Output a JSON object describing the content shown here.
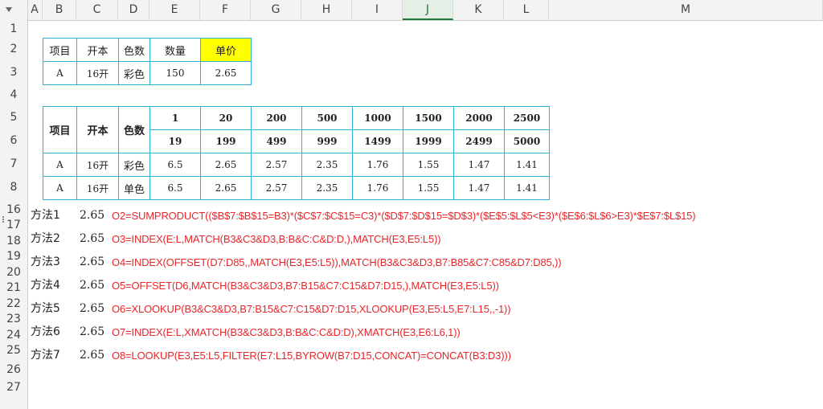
{
  "columns": [
    "A",
    "B",
    "C",
    "D",
    "E",
    "F",
    "G",
    "H",
    "I",
    "J",
    "K",
    "L",
    "M"
  ],
  "rows": [
    "1",
    "2",
    "3",
    "4",
    "5",
    "6",
    "7",
    "8",
    "16",
    "17",
    "18",
    "19",
    "20",
    "21",
    "22",
    "23",
    "24",
    "25",
    "26",
    "27"
  ],
  "table1": {
    "headers": [
      "项目",
      "开本",
      "色数",
      "数量",
      "单价"
    ],
    "row": [
      "A",
      "16开",
      "彩色",
      "150",
      "2.65"
    ]
  },
  "table2": {
    "head_left": [
      "项目",
      "开本",
      "色数"
    ],
    "range_from": [
      "1",
      "20",
      "200",
      "500",
      "1000",
      "1500",
      "2000",
      "2500"
    ],
    "range_to": [
      "19",
      "199",
      "499",
      "999",
      "1499",
      "1999",
      "2499",
      "5000"
    ],
    "rows": [
      [
        "A",
        "16开",
        "彩色",
        "6.5",
        "2.65",
        "2.57",
        "2.35",
        "1.76",
        "1.55",
        "1.47",
        "1.41"
      ],
      [
        "A",
        "16开",
        "单色",
        "6.5",
        "2.65",
        "2.57",
        "2.35",
        "1.76",
        "1.55",
        "1.47",
        "1.41"
      ]
    ]
  },
  "methods": [
    {
      "label": "方法1",
      "value": "2.65",
      "formula": "O2=SUMPRODUCT(($B$7:$B$15=B3)*($C$7:$C$15=C3)*($D$7:$D$15=$D$3)*($E$5:$L$5<E3)*($E$6:$L$6>E3)*$E$7:$L$15)"
    },
    {
      "label": "方法2",
      "value": "2.65",
      "formula": "O3=INDEX(E:L,MATCH(B3&C3&D3,B:B&C:C&D:D,),MATCH(E3,E5:L5))"
    },
    {
      "label": "方法3",
      "value": "2.65",
      "formula": "O4=INDEX(OFFSET(D7:D85,,MATCH(E3,E5:L5)),MATCH(B3&C3&D3,B7:B85&C7:C85&D7:D85,))"
    },
    {
      "label": "方法4",
      "value": "2.65",
      "formula": "O5=OFFSET(D6,MATCH(B3&C3&D3,B7:B15&C7:C15&D7:D15,),MATCH(E3,E5:L5))"
    },
    {
      "label": "方法5",
      "value": "2.65",
      "formula": "O6=XLOOKUP(B3&C3&D3,B7:B15&C7:C15&D7:D15,XLOOKUP(E3,E5:L5,E7:L15,,-1))"
    },
    {
      "label": "方法6",
      "value": "2.65",
      "formula": "O7=INDEX(E:L,XMATCH(B3&C3&D3,B:B&C:C&D:D),XMATCH(E3,E6:L6,1))"
    },
    {
      "label": "方法7",
      "value": "2.65",
      "formula": "O8=LOOKUP(E3,E5:L5,FILTER(E7:L15,BYROW(B7:D15,CONCAT)=CONCAT(B3:D3)))"
    }
  ],
  "colors": {
    "accent": "#1f7a3a",
    "border": "#2fb0d8",
    "formula": "#e8262a",
    "highlight": "#ffff00"
  }
}
